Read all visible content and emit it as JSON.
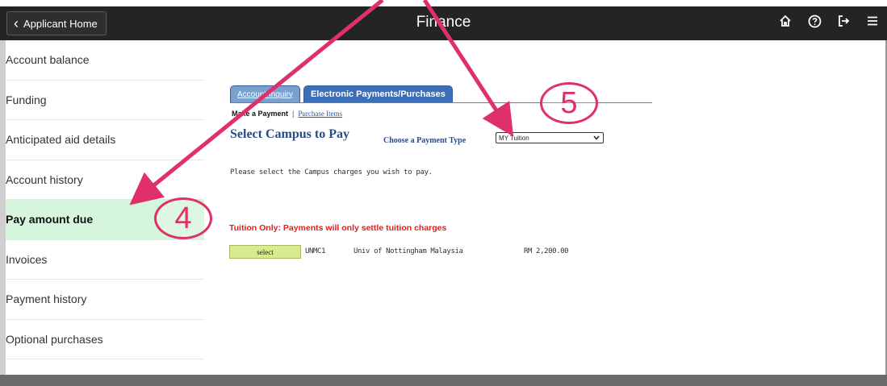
{
  "header": {
    "back_label": "Applicant Home",
    "title": "Finance",
    "icons": [
      "home-icon",
      "help-icon",
      "signout-icon",
      "menu-icon"
    ]
  },
  "sidebar": {
    "items": [
      {
        "label": "Account balance"
      },
      {
        "label": "Funding"
      },
      {
        "label": "Anticipated aid details"
      },
      {
        "label": "Account history"
      },
      {
        "label": "Pay amount due",
        "active": true
      },
      {
        "label": "Invoices"
      },
      {
        "label": "Payment history"
      },
      {
        "label": "Optional purchases"
      }
    ]
  },
  "main": {
    "tabs": [
      {
        "label": "Account Inquiry",
        "active": false
      },
      {
        "label": "Electronic Payments/Purchases",
        "active": true
      }
    ],
    "subnav": {
      "current": "Make a Payment",
      "separator": "|",
      "link": "Purchase Items"
    },
    "heading": "Select Campus to Pay",
    "payment_type_label": "Choose a Payment Type",
    "payment_type_value": "MY Tuition",
    "instruction": "Please select the Campus charges you wish to pay.",
    "notice": "Tuition Only: Payments will only settle tuition charges",
    "rows": [
      {
        "button": "select",
        "code": "UNMC1",
        "campus": "Univ of Nottingham Malaysia",
        "amount": "RM 2,200.00"
      }
    ]
  },
  "annotations": {
    "callout_4": "4",
    "callout_5": "5",
    "color": "#e0306c"
  },
  "colors": {
    "active_item_bg": "#d5f5dd",
    "topbar_bg": "#242424",
    "notice_red": "#e0201e",
    "select_btn_bg": "#d8ec8e"
  }
}
